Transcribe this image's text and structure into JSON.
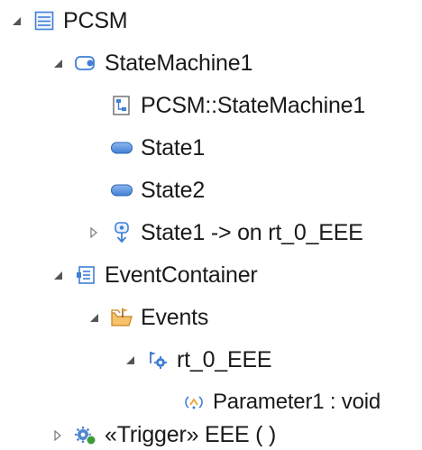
{
  "tree": {
    "root": {
      "label": "PCSM",
      "icon": "model-file-icon"
    },
    "state_machine": {
      "label": "StateMachine1",
      "icon": "state-machine-icon"
    },
    "diagram": {
      "label": "PCSM::StateMachine1",
      "icon": "diagram-icon"
    },
    "state1": {
      "label": "State1",
      "icon": "state-icon"
    },
    "state2": {
      "label": "State2",
      "icon": "state-icon"
    },
    "transition": {
      "label": "State1 ->  on rt_0_EEE",
      "icon": "transition-icon"
    },
    "event_container": {
      "label": "EventContainer",
      "icon": "event-container-icon"
    },
    "events_folder": {
      "label": "Events",
      "icon": "folder-icon"
    },
    "event": {
      "label": "rt_0_EEE",
      "icon": "event-icon"
    },
    "parameter": {
      "label": "Parameter1 : void",
      "icon": "parameter-icon"
    },
    "trigger": {
      "label": "«Trigger» EEE ( )",
      "icon": "trigger-icon"
    }
  },
  "colors": {
    "accent_blue": "#3f7fd6",
    "state_blue": "#5a93e0",
    "folder_orange": "#e8a13a",
    "trigger_green": "#3d9a3d",
    "twisty_gray": "#6b6b6b"
  }
}
